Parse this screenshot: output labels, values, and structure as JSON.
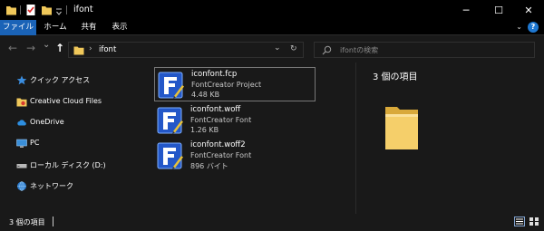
{
  "window": {
    "title": "ifont",
    "minimize": "─",
    "maximize": "☐",
    "close": "✕"
  },
  "ribbon": {
    "tabs": [
      "ファイル",
      "ホーム",
      "共有",
      "表示"
    ],
    "accent": "#1a63b7"
  },
  "navbar": {
    "back": "←",
    "forward": "→",
    "recent": "⌄",
    "up": "↑",
    "path_separator": "›",
    "path": "ifont",
    "dropdown": "⌄",
    "refresh": "↻",
    "search_icon": "⚲",
    "search_placeholder": "ifontの検索"
  },
  "sidebar": {
    "items": [
      {
        "label": "クイック アクセス",
        "icon": "star-icon"
      },
      {
        "label": "Creative Cloud Files",
        "icon": "creative-cloud-folder-icon"
      },
      {
        "label": "OneDrive",
        "icon": "cloud-icon"
      },
      {
        "label": "PC",
        "icon": "monitor-icon"
      },
      {
        "label": "ローカル ディスク (D:)",
        "icon": "drive-icon"
      },
      {
        "label": "ネットワーク",
        "icon": "network-icon"
      }
    ]
  },
  "files": [
    {
      "name": "iconfont.fcp",
      "type": "FontCreator Project",
      "size": "4.48 KB",
      "selected": true
    },
    {
      "name": "iconfont.woff",
      "type": "FontCreator Font",
      "size": "1.26 KB",
      "selected": false
    },
    {
      "name": "iconfont.woff2",
      "type": "FontCreator Font",
      "size": "896 バイト",
      "selected": false
    }
  ],
  "preview": {
    "count_text": "3 個の項目"
  },
  "status": {
    "count_text": "3 個の項目"
  },
  "colors": {
    "background": "#191919",
    "titlebar": "#000000",
    "folder_yellow": "#f0c85a",
    "icon_blue": "#1e4fc0"
  }
}
